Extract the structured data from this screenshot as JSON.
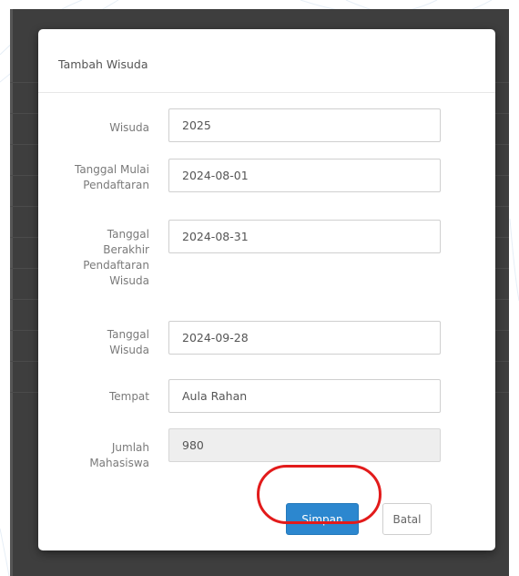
{
  "modal": {
    "title": "Tambah Wisuda",
    "fields": {
      "wisuda": {
        "label": "Wisuda",
        "value": "2025"
      },
      "tanggal_mulai": {
        "label": "Tanggal Mulai Pendaftaran",
        "value": "2024-08-01"
      },
      "tanggal_berakhir": {
        "label": "Tanggal Berakhir Pendaftaran Wisuda",
        "value": "2024-08-31"
      },
      "tanggal_wisuda": {
        "label": "Tanggal Wisuda",
        "value": "2024-09-28"
      },
      "tempat": {
        "label": "Tempat",
        "value": "Aula Rahan"
      },
      "jumlah_mahasiswa": {
        "label": "Jumlah Mahasiswa",
        "value": "980"
      }
    },
    "buttons": {
      "save_label": "Simpan",
      "cancel_label": "Batal"
    }
  },
  "colors": {
    "primary": "#2c87cf",
    "highlight": "#e21b1b",
    "overlay": "#3e3e3e"
  }
}
